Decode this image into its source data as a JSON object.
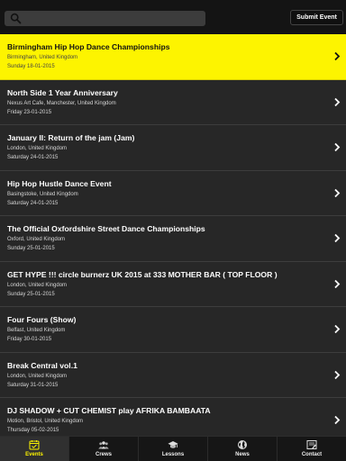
{
  "header": {
    "search_placeholder": "",
    "submit_label": "Submit Event"
  },
  "events": [
    {
      "title": "Birmingham Hip Hop Dance Championships",
      "location": "Birmingham, United Kingdom",
      "date": "Sunday 18-01-2015"
    },
    {
      "title": "North Side 1 Year Anniversary",
      "location": "Nexus Art Cafe, Manchester, United Kingdom",
      "date": "Friday 23-01-2015"
    },
    {
      "title": "January II: Return of the jam (Jam)",
      "location": "London, United Kingdom",
      "date": "Saturday 24-01-2015"
    },
    {
      "title": "Hip Hop Hustle Dance Event",
      "location": "Basingstoke, United Kingdom",
      "date": "Saturday 24-01-2015"
    },
    {
      "title": "The Official Oxfordshire Street Dance Championships",
      "location": "Oxford, United Kingdom",
      "date": "Sunday 25-01-2015"
    },
    {
      "title": "GET HYPE !!! circle burnerz UK 2015 at 333 MOTHER BAR ( TOP FLOOR )",
      "location": "London, United Kingdom",
      "date": "Sunday 25-01-2015"
    },
    {
      "title": "Four Fours (Show)",
      "location": "Belfast, United Kingdom",
      "date": "Friday 30-01-2015"
    },
    {
      "title": "Break Central vol.1",
      "location": "London, United Kingdom",
      "date": "Saturday 31-01-2015"
    },
    {
      "title": "DJ SHADOW + CUT CHEMIST play AFRIKA BAMBAATA",
      "location": "Motion, Bristol, United Kingdom",
      "date": "Thursday 05-02-2015"
    }
  ],
  "tabs": [
    {
      "label": "Events",
      "icon": "calendar-check-icon"
    },
    {
      "label": "Crews",
      "icon": "crews-icon"
    },
    {
      "label": "Lessons",
      "icon": "graduation-cap-icon"
    },
    {
      "label": "News",
      "icon": "globe-icon"
    },
    {
      "label": "Contact",
      "icon": "contact-icon"
    }
  ],
  "colors": {
    "accent": "#fdf400",
    "background": "#272727",
    "header": "#141414",
    "tabbar": "#161616"
  }
}
